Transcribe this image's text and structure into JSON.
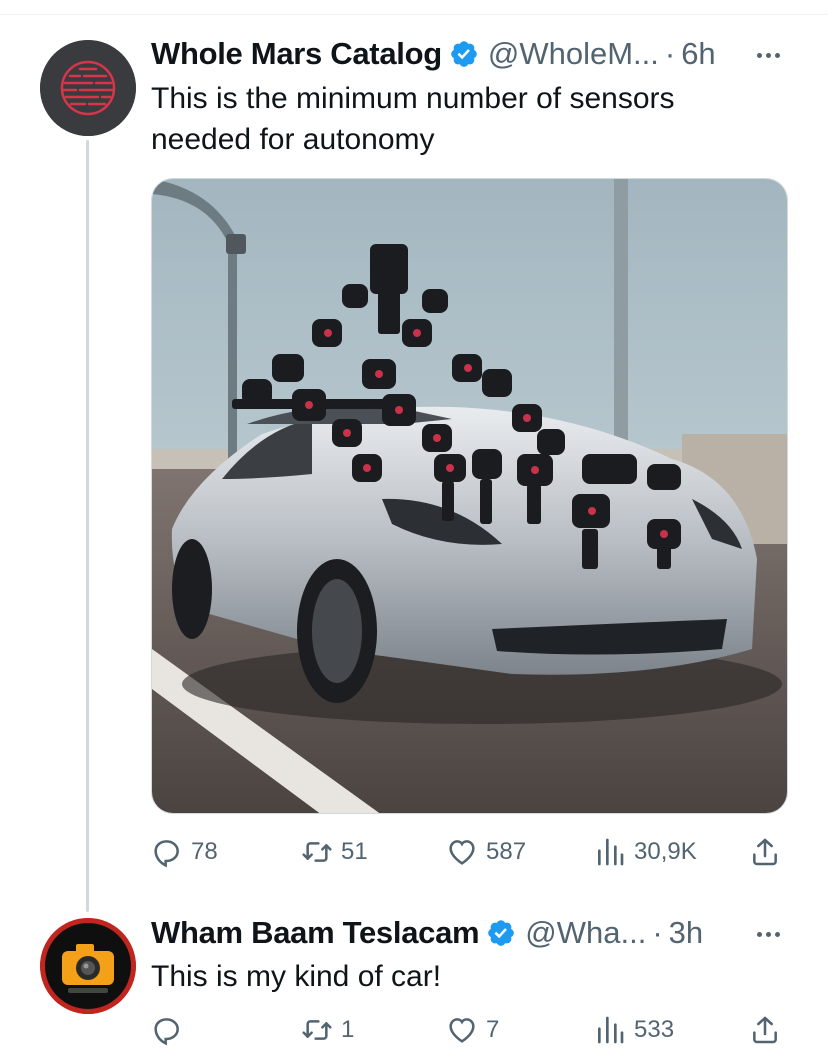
{
  "colors": {
    "text": "#0f1419",
    "muted": "#536471",
    "verified": "#1d9bf0",
    "thread_line": "#cfd9de"
  },
  "tweets": [
    {
      "author_name": "Whole Mars Catalog",
      "handle": "@WholeM...",
      "separator": "·",
      "time": "6h",
      "verified_icon": "verified-badge-icon",
      "text": "This is the minimum number of sensors needed for autonomy",
      "has_media": true,
      "actions": {
        "replies": "78",
        "retweets": "51",
        "likes": "587",
        "views": "30,9K"
      }
    },
    {
      "author_name": "Wham Baam Teslacam",
      "handle": "@Wha...",
      "separator": "·",
      "time": "3h",
      "verified_icon": "verified-badge-icon",
      "text": "This is my kind of car!",
      "has_media": false,
      "actions": {
        "replies": "",
        "retweets": "1",
        "likes": "7",
        "views": "533"
      }
    }
  ]
}
